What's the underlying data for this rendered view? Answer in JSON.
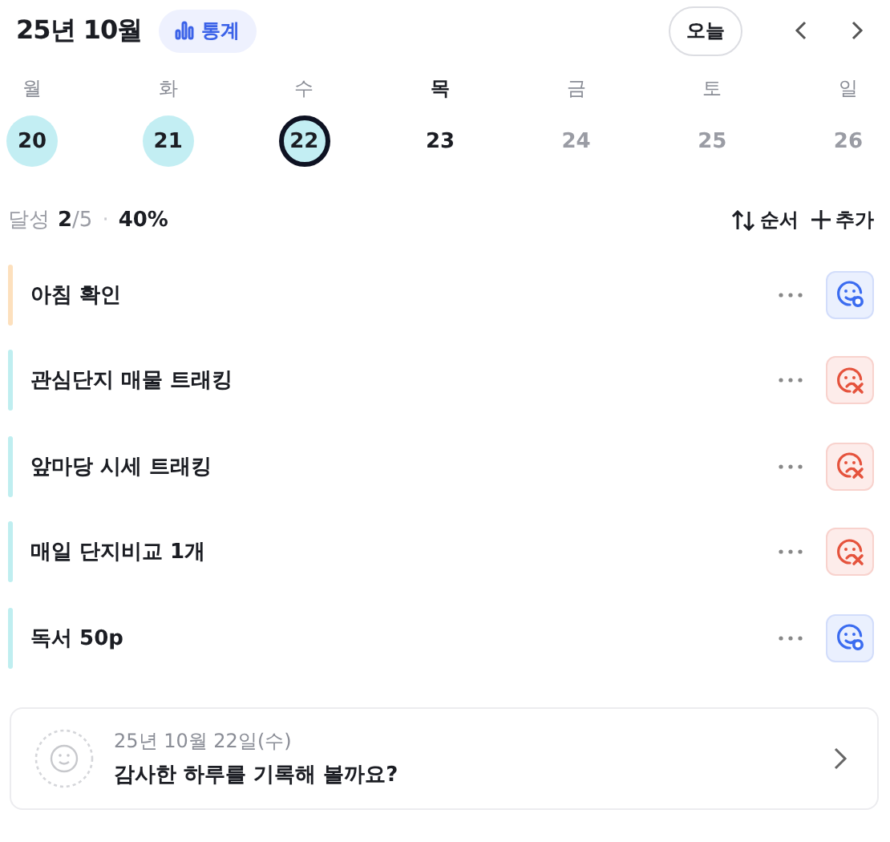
{
  "header": {
    "title": "25년 10월",
    "stats_button": "통계",
    "today_button": "오늘"
  },
  "days": [
    {
      "weekday": "월",
      "date": "20",
      "done": true,
      "selected": false,
      "today": false,
      "future": false
    },
    {
      "weekday": "화",
      "date": "21",
      "done": true,
      "selected": false,
      "today": false,
      "future": false
    },
    {
      "weekday": "수",
      "date": "22",
      "done": true,
      "selected": true,
      "today": false,
      "future": false
    },
    {
      "weekday": "목",
      "date": "23",
      "done": false,
      "selected": false,
      "today": true,
      "future": false
    },
    {
      "weekday": "금",
      "date": "24",
      "done": false,
      "selected": false,
      "today": false,
      "future": true
    },
    {
      "weekday": "토",
      "date": "25",
      "done": false,
      "selected": false,
      "today": false,
      "future": true
    },
    {
      "weekday": "일",
      "date": "26",
      "done": false,
      "selected": false,
      "today": false,
      "future": true
    }
  ],
  "progress": {
    "label": "달성",
    "done": "2",
    "total": "/5",
    "separator": "·",
    "percent": "40%",
    "sort_button": "순서",
    "add_button": "추가"
  },
  "tasks": [
    {
      "name": "아침 확인",
      "color": "#fde0bd",
      "success": true
    },
    {
      "name": "관심단지 매물 트래킹",
      "color": "#bfeef0",
      "success": false
    },
    {
      "name": "앞마당 시세 트래킹",
      "color": "#bfeef0",
      "success": false
    },
    {
      "name": "매일 단지비교 1개",
      "color": "#bfeef0",
      "success": false
    },
    {
      "name": "독서 50p",
      "color": "#bfeef0",
      "success": true
    }
  ],
  "journal": {
    "date": "25년 10월 22일(수)",
    "prompt": "감사한 하루를 기록해 볼까요?"
  }
}
